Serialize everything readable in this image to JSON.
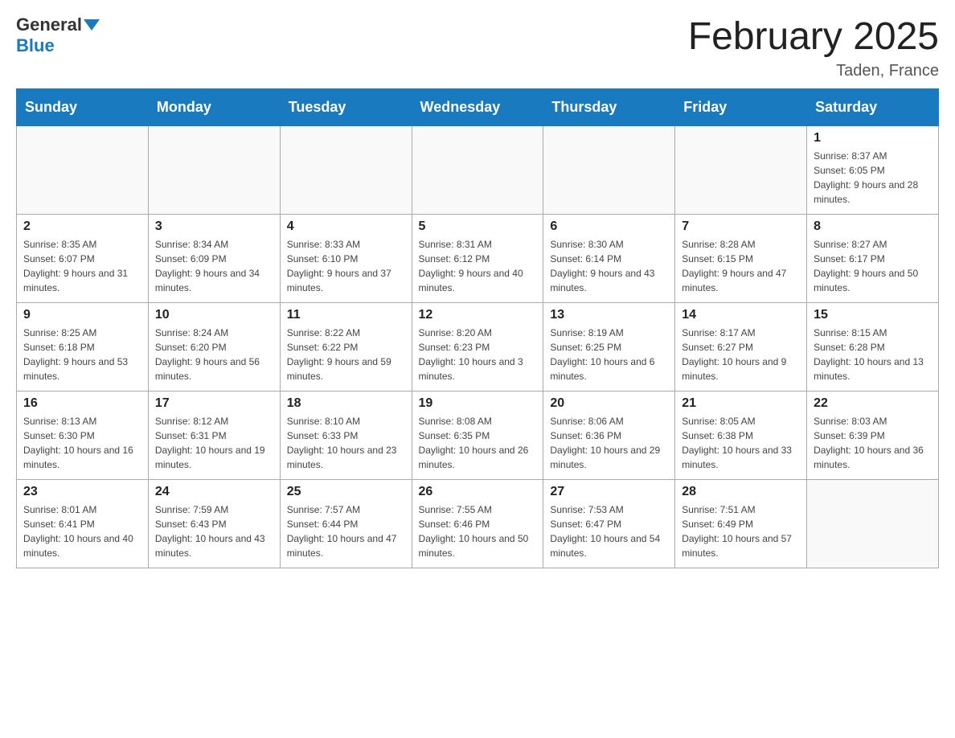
{
  "header": {
    "logo_main": "General",
    "logo_blue": "Blue",
    "title": "February 2025",
    "subtitle": "Taden, France"
  },
  "days_of_week": [
    "Sunday",
    "Monday",
    "Tuesday",
    "Wednesday",
    "Thursday",
    "Friday",
    "Saturday"
  ],
  "weeks": [
    [
      {
        "day": "",
        "info": ""
      },
      {
        "day": "",
        "info": ""
      },
      {
        "day": "",
        "info": ""
      },
      {
        "day": "",
        "info": ""
      },
      {
        "day": "",
        "info": ""
      },
      {
        "day": "",
        "info": ""
      },
      {
        "day": "1",
        "info": "Sunrise: 8:37 AM\nSunset: 6:05 PM\nDaylight: 9 hours and 28 minutes."
      }
    ],
    [
      {
        "day": "2",
        "info": "Sunrise: 8:35 AM\nSunset: 6:07 PM\nDaylight: 9 hours and 31 minutes."
      },
      {
        "day": "3",
        "info": "Sunrise: 8:34 AM\nSunset: 6:09 PM\nDaylight: 9 hours and 34 minutes."
      },
      {
        "day": "4",
        "info": "Sunrise: 8:33 AM\nSunset: 6:10 PM\nDaylight: 9 hours and 37 minutes."
      },
      {
        "day": "5",
        "info": "Sunrise: 8:31 AM\nSunset: 6:12 PM\nDaylight: 9 hours and 40 minutes."
      },
      {
        "day": "6",
        "info": "Sunrise: 8:30 AM\nSunset: 6:14 PM\nDaylight: 9 hours and 43 minutes."
      },
      {
        "day": "7",
        "info": "Sunrise: 8:28 AM\nSunset: 6:15 PM\nDaylight: 9 hours and 47 minutes."
      },
      {
        "day": "8",
        "info": "Sunrise: 8:27 AM\nSunset: 6:17 PM\nDaylight: 9 hours and 50 minutes."
      }
    ],
    [
      {
        "day": "9",
        "info": "Sunrise: 8:25 AM\nSunset: 6:18 PM\nDaylight: 9 hours and 53 minutes."
      },
      {
        "day": "10",
        "info": "Sunrise: 8:24 AM\nSunset: 6:20 PM\nDaylight: 9 hours and 56 minutes."
      },
      {
        "day": "11",
        "info": "Sunrise: 8:22 AM\nSunset: 6:22 PM\nDaylight: 9 hours and 59 minutes."
      },
      {
        "day": "12",
        "info": "Sunrise: 8:20 AM\nSunset: 6:23 PM\nDaylight: 10 hours and 3 minutes."
      },
      {
        "day": "13",
        "info": "Sunrise: 8:19 AM\nSunset: 6:25 PM\nDaylight: 10 hours and 6 minutes."
      },
      {
        "day": "14",
        "info": "Sunrise: 8:17 AM\nSunset: 6:27 PM\nDaylight: 10 hours and 9 minutes."
      },
      {
        "day": "15",
        "info": "Sunrise: 8:15 AM\nSunset: 6:28 PM\nDaylight: 10 hours and 13 minutes."
      }
    ],
    [
      {
        "day": "16",
        "info": "Sunrise: 8:13 AM\nSunset: 6:30 PM\nDaylight: 10 hours and 16 minutes."
      },
      {
        "day": "17",
        "info": "Sunrise: 8:12 AM\nSunset: 6:31 PM\nDaylight: 10 hours and 19 minutes."
      },
      {
        "day": "18",
        "info": "Sunrise: 8:10 AM\nSunset: 6:33 PM\nDaylight: 10 hours and 23 minutes."
      },
      {
        "day": "19",
        "info": "Sunrise: 8:08 AM\nSunset: 6:35 PM\nDaylight: 10 hours and 26 minutes."
      },
      {
        "day": "20",
        "info": "Sunrise: 8:06 AM\nSunset: 6:36 PM\nDaylight: 10 hours and 29 minutes."
      },
      {
        "day": "21",
        "info": "Sunrise: 8:05 AM\nSunset: 6:38 PM\nDaylight: 10 hours and 33 minutes."
      },
      {
        "day": "22",
        "info": "Sunrise: 8:03 AM\nSunset: 6:39 PM\nDaylight: 10 hours and 36 minutes."
      }
    ],
    [
      {
        "day": "23",
        "info": "Sunrise: 8:01 AM\nSunset: 6:41 PM\nDaylight: 10 hours and 40 minutes."
      },
      {
        "day": "24",
        "info": "Sunrise: 7:59 AM\nSunset: 6:43 PM\nDaylight: 10 hours and 43 minutes."
      },
      {
        "day": "25",
        "info": "Sunrise: 7:57 AM\nSunset: 6:44 PM\nDaylight: 10 hours and 47 minutes."
      },
      {
        "day": "26",
        "info": "Sunrise: 7:55 AM\nSunset: 6:46 PM\nDaylight: 10 hours and 50 minutes."
      },
      {
        "day": "27",
        "info": "Sunrise: 7:53 AM\nSunset: 6:47 PM\nDaylight: 10 hours and 54 minutes."
      },
      {
        "day": "28",
        "info": "Sunrise: 7:51 AM\nSunset: 6:49 PM\nDaylight: 10 hours and 57 minutes."
      },
      {
        "day": "",
        "info": ""
      }
    ]
  ]
}
